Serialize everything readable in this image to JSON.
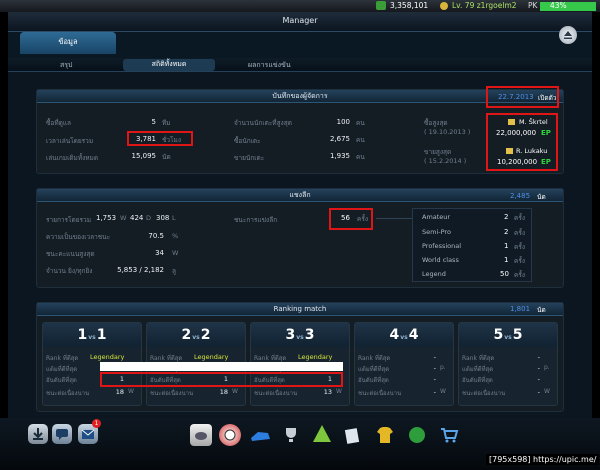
{
  "topbar": {
    "coins": "3,358,101",
    "level": "Lv. 79 z1rgoelm2",
    "battery": "43%",
    "flag": "PK"
  },
  "window": {
    "title": "Manager"
  },
  "tabs": {
    "main": "ข้อมูล",
    "sub": [
      "สรุป",
      "สถิติทั้งหมด",
      "ผลการแข่งขัน"
    ]
  },
  "record": {
    "title": "บันทึกของผู้จัดการ",
    "date": "22.7.2013",
    "since": "เปิดตัว",
    "left": [
      {
        "label": "ซื้อที่ดูแล",
        "value": "5",
        "unit": "ทีม"
      },
      {
        "label": "เวลาเล่นโดยรวม",
        "value": "3,781",
        "unit": "ชั่วโมง"
      },
      {
        "label": "เล่นเกมเดิมทั้งหมด",
        "value": "15,095",
        "unit": "นัด"
      }
    ],
    "mid": [
      {
        "label": "จำนวนนักเตะที่สูงสุด",
        "value": "100",
        "unit": "คน"
      },
      {
        "label": "ซื้อนักเตะ",
        "value": "2,675",
        "unit": "คน"
      },
      {
        "label": "ขายนักเตะ",
        "value": "1,935",
        "unit": "คน"
      }
    ],
    "buy": {
      "label": "ซื้อสูงสุด",
      "date": "( 19.10.2013 )",
      "player": "M. Škrtel",
      "price": "22,000,000",
      "ep": "EP"
    },
    "sell": {
      "label": "ขายสูงสุด",
      "date": "( 15.2.2014 )",
      "player": "R. Lukaku",
      "price": "10,200,000",
      "ep": "EP"
    }
  },
  "league": {
    "title": "แชงลีก",
    "total": "2,485",
    "total_unit": "นัด",
    "rows": [
      {
        "label": "รายการโดยรวม",
        "w": "1,753",
        "wu": "W",
        "d": "424",
        "du": "D",
        "l": "308",
        "lu": "L"
      },
      {
        "label": "ความเป็นของเวลาชนะ",
        "value": "70.5",
        "unit": "%"
      },
      {
        "label": "ชนะคะแนนสูงสุด",
        "value": "34",
        "unit": "W"
      },
      {
        "label": "จำนวน ยิง/ทุกยิง",
        "value": "5,853 / 2,182",
        "unit": "ลู"
      }
    ],
    "wins_label": "ชนะการแข่งลีก",
    "wins_value": "56",
    "wins_unit": "ครั้ง",
    "tiers": [
      {
        "name": "Amateur",
        "count": "2",
        "unit": "ครั้ง"
      },
      {
        "name": "Semi-Pro",
        "count": "2",
        "unit": "ครั้ง"
      },
      {
        "name": "Professional",
        "count": "1",
        "unit": "ครั้ง"
      },
      {
        "name": "World class",
        "count": "1",
        "unit": "ครั้ง"
      },
      {
        "name": "Legend",
        "count": "50",
        "unit": "ครั้ง"
      }
    ]
  },
  "ranking": {
    "title": "Ranking match",
    "total": "1,801",
    "total_unit": "นัด",
    "cards": [
      {
        "head": "1",
        "vs": "vs",
        "tail": "1",
        "rank_label": "Rank ที่ดีสุด",
        "rank": "Legendary",
        "pts_label": "แต้มที่ดีที่สุด",
        "pts": "",
        "pos_label": "อันดับดีที่สุด",
        "pos": "1",
        "streak_label": "ชนะต่อเนื่องนาน",
        "streak": "18",
        "streak_unit": "W"
      },
      {
        "head": "2",
        "vs": "vs",
        "tail": "2",
        "rank_label": "Rank ที่ดีสุด",
        "rank": "Legendary",
        "pts_label": "แต้มที่ดีที่สุด",
        "pts": "",
        "pos_label": "อันดับดีที่สุด",
        "pos": "1",
        "streak_label": "ชนะต่อเนื่องนาน",
        "streak": "18",
        "streak_unit": "W"
      },
      {
        "head": "3",
        "vs": "vs",
        "tail": "3",
        "rank_label": "Rank ที่ดีสุด",
        "rank": "Legendary",
        "pts_label": "แต้มที่ดีที่สุด",
        "pts": "",
        "pos_label": "อันดับดีที่สุด",
        "pos": "1",
        "streak_label": "ชนะต่อเนื่องนาน",
        "streak": "13",
        "streak_unit": "W"
      },
      {
        "head": "4",
        "vs": "vs",
        "tail": "4",
        "rank_label": "Rank ที่ดีสุด",
        "rank": "-",
        "pts_label": "แต้มที่ดีที่สุด",
        "pts": "-",
        "pts_unit": "p.",
        "pos_label": "อันดับดีที่สุด",
        "pos": "-",
        "streak_label": "ชนะต่อเนื่องนาน",
        "streak": "-",
        "streak_unit": "W"
      },
      {
        "head": "5",
        "vs": "vs",
        "tail": "5",
        "rank_label": "Rank ที่ดีสุด",
        "rank": "-",
        "pts_label": "แต้มที่ดีที่สุด",
        "pts": "-",
        "pts_unit": "p.",
        "pos_label": "อันดับดีที่สุด",
        "pos": "-",
        "streak_label": "ชนะต่อเนื่องนาน",
        "streak": "-",
        "streak_unit": "W"
      }
    ]
  },
  "bottom": {
    "badge": "1"
  },
  "watermark": "[795x598] https://upic.me/"
}
